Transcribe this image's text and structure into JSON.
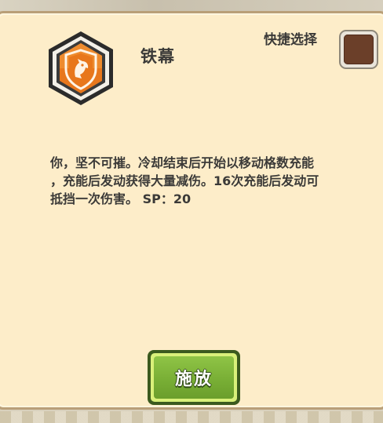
{
  "skill": {
    "name": "铁幕",
    "icon": "shield-horse-icon",
    "description_lines": [
      "你，坚不可摧。冷却结束后开始以移动格数充能",
      "，充能后发动获得大量减伤。16次充能后发动可",
      "抵挡一次伤害。  SP：20"
    ]
  },
  "quick_select": {
    "label": "快捷选择",
    "slot_color": "#6b3f29"
  },
  "actions": {
    "cast_label": "施放"
  },
  "colors": {
    "panel_bg": "#fdedc9",
    "button_green": "#77ad34",
    "icon_orange": "#e8771c"
  }
}
